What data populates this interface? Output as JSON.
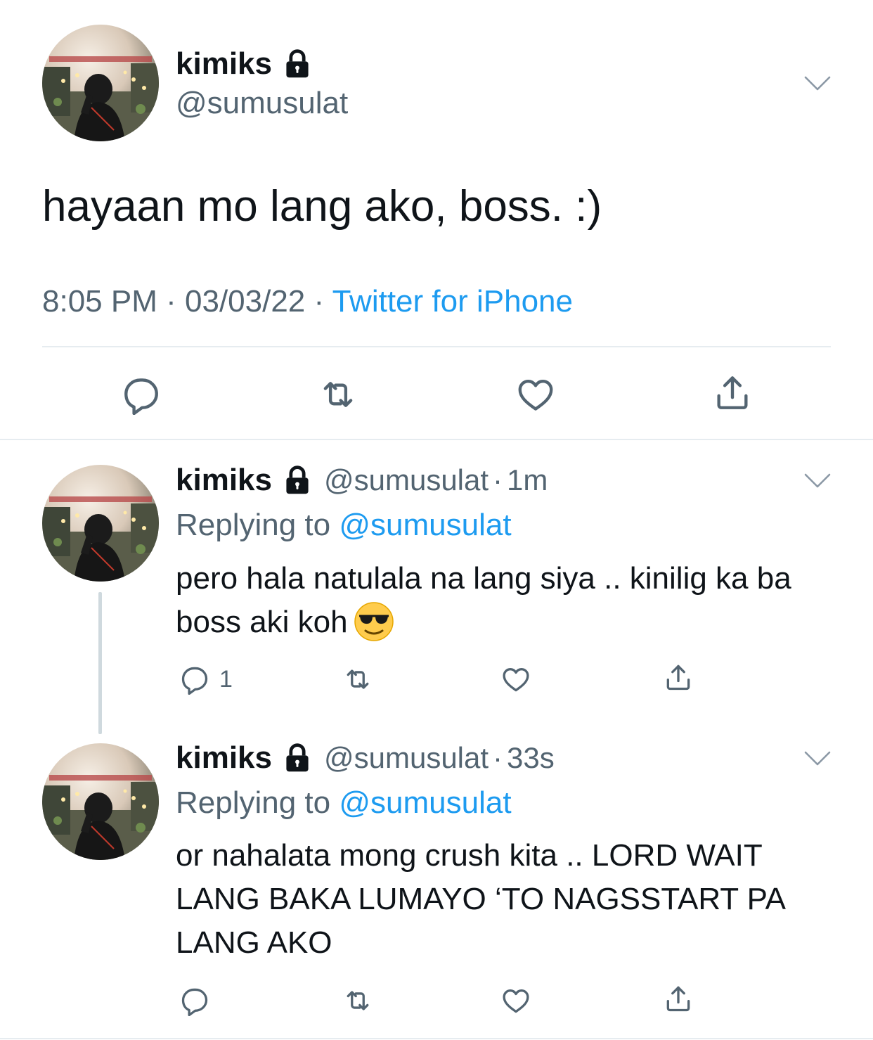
{
  "main_tweet": {
    "author": {
      "name": "kimiks",
      "handle": "@sumusulat",
      "lock_icon": "lock-icon"
    },
    "text": "hayaan mo lang ako, boss. :)",
    "time": "8:05 PM",
    "separator": "·",
    "date": "03/03/22",
    "source": "Twitter for iPhone",
    "actions": [
      "reply-icon",
      "retweet-icon",
      "like-icon",
      "share-icon"
    ]
  },
  "replies": [
    {
      "name": "kimiks",
      "handle": "@sumusulat",
      "separator": "·",
      "time": "1m",
      "replying_prefix": "Replying to",
      "replying_to": "@sumusulat",
      "text": "pero hala natulala na lang siya .. kinilig ka ba boss aki koh",
      "emoji": "smiling-face-with-sunglasses",
      "reply_count": "1"
    },
    {
      "name": "kimiks",
      "handle": "@sumusulat",
      "separator": "·",
      "time": "33s",
      "replying_prefix": "Replying to",
      "replying_to": "@sumusulat",
      "text": "or nahalata mong crush kita .. LORD WAIT LANG BAKA LUMAYO ‘TO NAGSSTART PA LANG AKO"
    }
  ],
  "colors": {
    "text": "#0f1419",
    "secondary": "#536471",
    "link": "#1d9bf0",
    "divider": "#e6ecf0",
    "thread_line": "#cfd9de"
  }
}
